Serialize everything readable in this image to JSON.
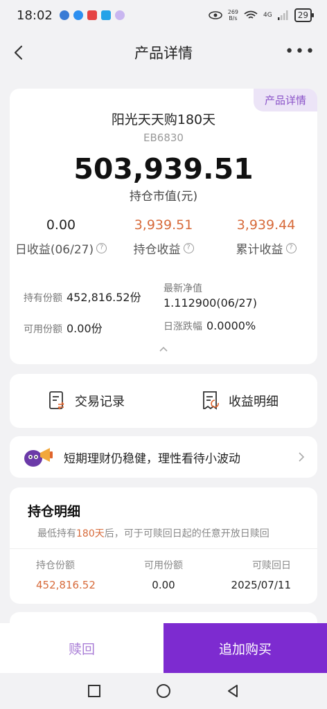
{
  "status_bar": {
    "time": "18:02",
    "net_speed_top": "269",
    "net_speed_bottom": "B/s",
    "signal": "4G",
    "battery": "29"
  },
  "header": {
    "title": "产品详情",
    "more": "•••"
  },
  "summary": {
    "tag": "产品详情",
    "product_name": "阳光天天购180天",
    "product_code": "EB6830",
    "market_value": "503,939.51",
    "market_value_label": "持仓市值(元)",
    "metrics": [
      {
        "value": "0.00",
        "label": "日收益(06/27)"
      },
      {
        "value": "3,939.51",
        "label": "持仓收益"
      },
      {
        "value": "3,939.44",
        "label": "累计收益"
      }
    ],
    "details": {
      "held_shares_label": "持有份额",
      "held_shares": "452,816.52份",
      "nav_label": "最新净值",
      "nav": "1.112900(06/27)",
      "available_label": "可用份额",
      "available": "0.00份",
      "daily_change_label": "日涨跌幅",
      "daily_change": "0.0000%"
    }
  },
  "records": {
    "trade_label": "交易记录",
    "income_label": "收益明细"
  },
  "notice": {
    "text": "短期理财仍稳健，理性看待小波动"
  },
  "holdings": {
    "title": "持仓明细",
    "desc_prefix": "最低持有",
    "desc_highlight": "180天",
    "desc_suffix": "后，可于可赎回日起的任意开放日赎回",
    "headers": [
      "持仓份额",
      "可用份额",
      "可赎回日"
    ],
    "row": [
      "452,816.52",
      "0.00",
      "2025/07/11"
    ]
  },
  "bottom_bar": {
    "redeem_label": "赎回",
    "buy_label": "追加购买"
  },
  "colors": {
    "accent": "#7d2bd0",
    "orange": "#d76a3a",
    "tag_bg": "#ece4f7"
  }
}
